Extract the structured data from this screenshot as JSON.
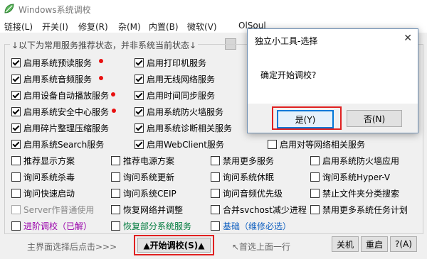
{
  "window": {
    "title": "Windows系统调校"
  },
  "menu": [
    {
      "label": "链接(L)"
    },
    {
      "label": "开关(I)"
    },
    {
      "label": "修复(R)"
    },
    {
      "label": "杂(M)"
    },
    {
      "label": "内置(B)"
    },
    {
      "label": "微软(V)"
    },
    {
      "label": "OlSoul"
    }
  ],
  "group": {
    "title": "↓以下为常用服务推荐状态，并非系统当前状态↓"
  },
  "checkboxes": [
    {
      "label": "启用系统预读服务",
      "checked": true,
      "reddot": true
    },
    {
      "label": "启用打印机服务",
      "checked": true
    },
    {
      "label": "启用系统音频服务",
      "checked": true,
      "reddot": true
    },
    {
      "label": "启用无线网络服务",
      "checked": true
    },
    {
      "label": "启用设备自动播放服务",
      "checked": true,
      "reddot": true
    },
    {
      "label": "启用时间同步服务",
      "checked": true
    },
    {
      "label": "启用系统安全中心服务",
      "checked": true,
      "reddot": true
    },
    {
      "label": "启用系统防火墙服务",
      "checked": true
    },
    {
      "label": "启用碎片整理压缩服务",
      "checked": true
    },
    {
      "label": "启用系统诊断相关服务",
      "checked": true
    },
    {
      "label": "启用系统Search服务",
      "checked": true
    },
    {
      "label": "启用WebClient服务",
      "checked": true
    },
    {
      "label": "启用对等网络相关服务",
      "checked": false
    },
    {
      "label": "推荐显示方案",
      "checked": false
    },
    {
      "label": "推荐电源方案",
      "checked": false
    },
    {
      "label": "禁用更多服务",
      "checked": false
    },
    {
      "label": "启用系统防火墙应用",
      "checked": false
    },
    {
      "label": "询问系统杀毒",
      "checked": false
    },
    {
      "label": "询问系统更新",
      "checked": false
    },
    {
      "label": "询问系统休眠",
      "checked": false
    },
    {
      "label": "询问系统Hyper-V",
      "checked": false
    },
    {
      "label": "询问快速启动",
      "checked": false
    },
    {
      "label": "询问系统CEIP",
      "checked": false
    },
    {
      "label": "询问音频优先级",
      "checked": false
    },
    {
      "label": "禁止文件夹分类搜索",
      "checked": false
    },
    {
      "label": "Server作普通使用",
      "checked": false,
      "disabled": true
    },
    {
      "label": "恢复网络并调整",
      "checked": false
    },
    {
      "label": "合并svchost减少进程",
      "checked": false
    },
    {
      "label": "禁用更多系统任务计划",
      "checked": false
    },
    {
      "label": "进阶调校（已解）",
      "checked": false,
      "color": "#9900aa"
    },
    {
      "label": "恢复部分系统服务",
      "checked": false,
      "color": "#007a3d"
    },
    {
      "label": "基础（维修必选）",
      "checked": false,
      "color": "#1060c0"
    }
  ],
  "bottom": {
    "hint_left": "主界面选择后点击>>>",
    "start_button": "▲开始调校(S)▲",
    "hint_right": "↖首选上面一行",
    "shutdown": "关机",
    "restart": "重启",
    "about": "?(A)"
  },
  "dialog": {
    "title": "独立小工具-选择",
    "close": "✕",
    "message": "确定开始调校?",
    "yes": "是(Y)",
    "no": "否(N)"
  },
  "colors": {
    "highlight_frame": "#e02020",
    "reddot": "#e81010",
    "default_button_border": "#0078d7"
  }
}
